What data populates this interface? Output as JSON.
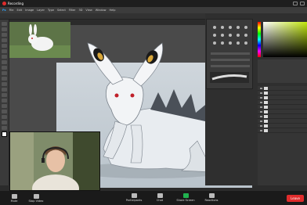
{
  "recording": {
    "label": "Recording"
  },
  "ps_menu": [
    "Ps",
    "File",
    "Edit",
    "Image",
    "Layer",
    "Type",
    "Select",
    "Filter",
    "3D",
    "View",
    "Window",
    "Help"
  ],
  "zoom_controls": {
    "mute": "Mute",
    "stop_video": "Stop Video",
    "participants": "Participants",
    "chat": "Chat",
    "share_screen": "Share Screen",
    "reactions": "Reactions",
    "leave": "Leave"
  },
  "colors": {
    "record": "#e02c2c",
    "share": "#21b24f",
    "zoom_bar": "#1a1a1a"
  }
}
